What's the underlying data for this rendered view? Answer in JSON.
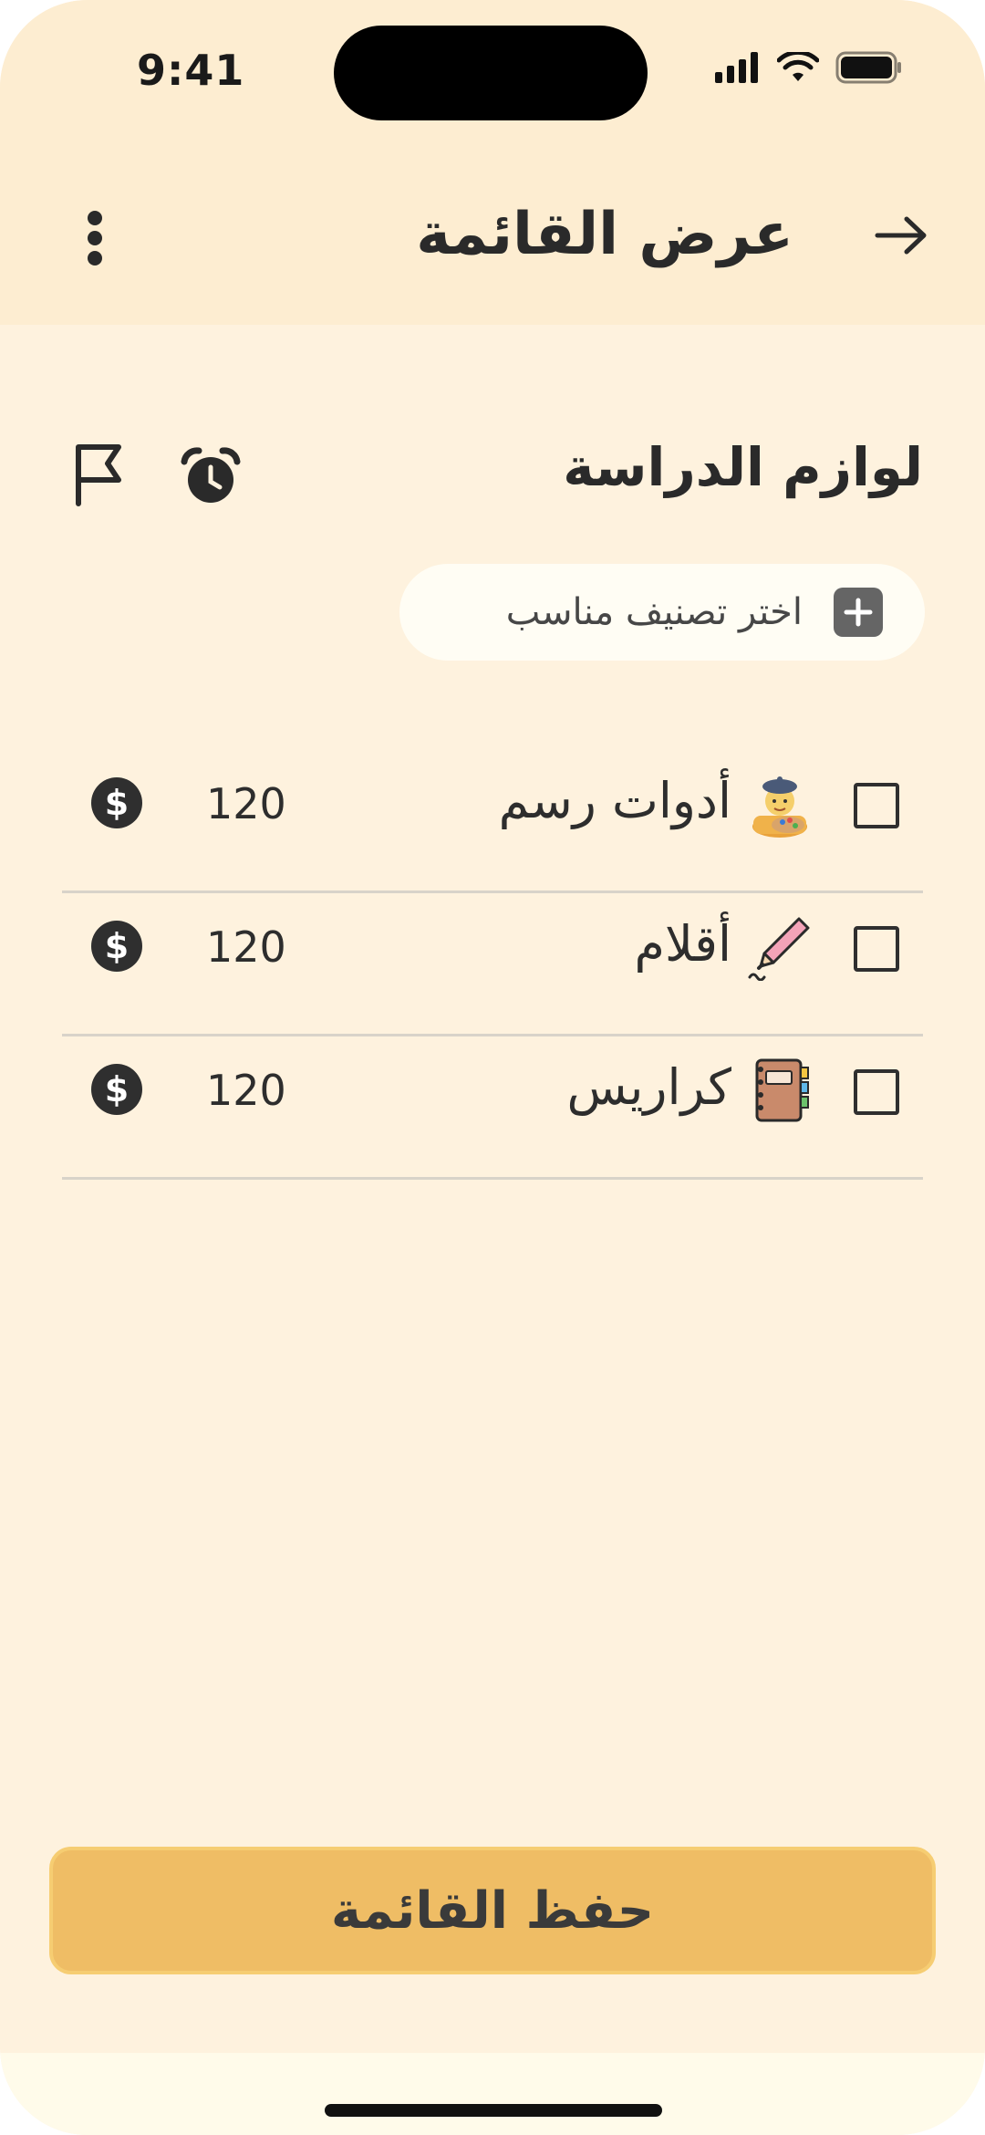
{
  "status_bar": {
    "time": "9:41"
  },
  "header": {
    "title": "عرض القائمة"
  },
  "list": {
    "title": "لوازم الدراسة",
    "category_chip_label": "اختر تصنيف مناسب"
  },
  "items": [
    {
      "name": "أدوات رسم",
      "emoji": "artist-emoji",
      "price": "120",
      "checked": false
    },
    {
      "name": "أقلام",
      "emoji": "pen-emoji",
      "price": "120",
      "checked": false
    },
    {
      "name": "كراريس",
      "emoji": "notebook-emoji",
      "price": "120",
      "checked": false
    }
  ],
  "save_button_label": "حفظ القائمة",
  "colors": {
    "background": "#fef2de",
    "header": "#fdedd1",
    "accent": "#efbd65"
  }
}
